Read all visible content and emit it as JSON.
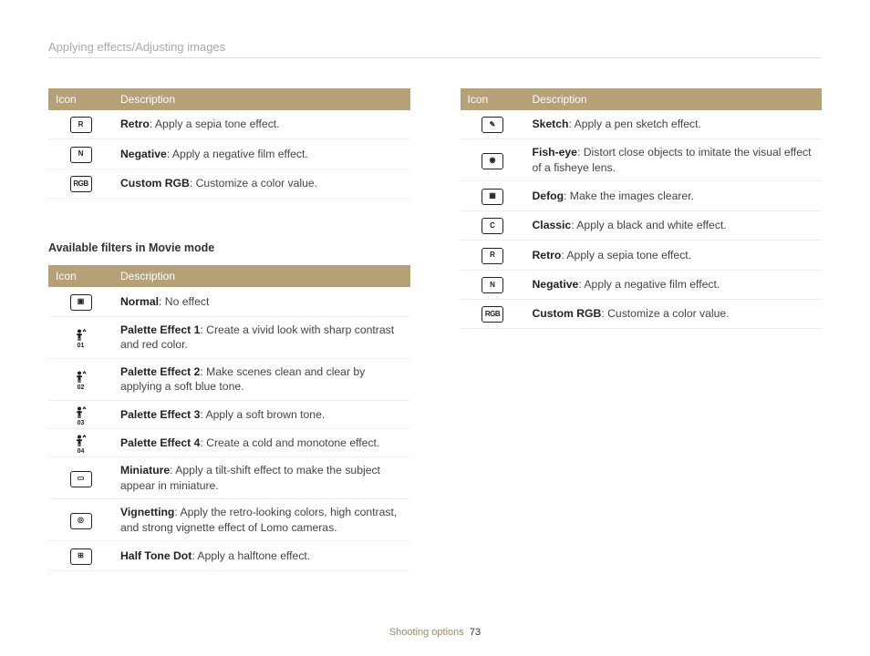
{
  "breadcrumb": "Applying effects/Adjusting images",
  "table1": {
    "head_icon": "Icon",
    "head_desc": "Description",
    "rows": [
      {
        "glyph": "R",
        "icon_name": "retro-icon",
        "term": "Retro",
        "desc": ": Apply a sepia tone effect."
      },
      {
        "glyph": "N",
        "icon_name": "negative-icon",
        "term": "Negative",
        "desc": ": Apply a negative film effect."
      },
      {
        "glyph": "RGB",
        "icon_name": "custom-rgb-icon",
        "term": "Custom RGB",
        "desc": ": Customize a color value."
      }
    ]
  },
  "section_title": "Available filters in Movie mode",
  "table2": {
    "head_icon": "Icon",
    "head_desc": "Description",
    "rows": [
      {
        "glyph": "▣",
        "icon_name": "normal-icon",
        "term": "Normal",
        "desc": ": No effect"
      },
      {
        "glyph": "01",
        "icon_name": "palette1-icon",
        "term": "Palette Effect 1",
        "desc": ": Create a vivid look with sharp contrast and red color."
      },
      {
        "glyph": "02",
        "icon_name": "palette2-icon",
        "term": "Palette Effect 2",
        "desc": ": Make scenes clean and clear by applying a soft blue tone."
      },
      {
        "glyph": "03",
        "icon_name": "palette3-icon",
        "term": "Palette Effect 3",
        "desc": ": Apply a soft brown tone."
      },
      {
        "glyph": "04",
        "icon_name": "palette4-icon",
        "term": "Palette Effect 4",
        "desc": ": Create a cold and monotone effect."
      },
      {
        "glyph": "▭",
        "icon_name": "miniature-icon",
        "term": "Miniature",
        "desc": ": Apply a tilt-shift effect to make the subject appear in miniature."
      },
      {
        "glyph": "◎",
        "icon_name": "vignetting-icon",
        "term": "Vignetting",
        "desc": ": Apply the retro-looking colors, high contrast, and strong vignette effect of Lomo cameras."
      },
      {
        "glyph": "⊞",
        "icon_name": "halftone-icon",
        "term": "Half Tone Dot",
        "desc": ": Apply a halftone effect."
      }
    ]
  },
  "table3": {
    "head_icon": "Icon",
    "head_desc": "Description",
    "rows": [
      {
        "glyph": "✎",
        "icon_name": "sketch-icon",
        "term": "Sketch",
        "desc": ": Apply a pen sketch effect."
      },
      {
        "glyph": "◉",
        "icon_name": "fisheye-icon",
        "term": "Fish-eye",
        "desc": ": Distort close objects to imitate the visual effect of a fisheye lens."
      },
      {
        "glyph": "▦",
        "icon_name": "defog-icon",
        "term": "Defog",
        "desc": ": Make the images clearer."
      },
      {
        "glyph": "C",
        "icon_name": "classic-icon",
        "term": "Classic",
        "desc": ": Apply a black and white effect."
      },
      {
        "glyph": "R",
        "icon_name": "retro-icon",
        "term": "Retro",
        "desc": ": Apply a sepia tone effect."
      },
      {
        "glyph": "N",
        "icon_name": "negative-icon",
        "term": "Negative",
        "desc": ": Apply a negative film effect."
      },
      {
        "glyph": "RGB",
        "icon_name": "custom-rgb-icon",
        "term": "Custom RGB",
        "desc": ": Customize a color value."
      }
    ]
  },
  "footer_section": "Shooting options",
  "footer_page": "73"
}
